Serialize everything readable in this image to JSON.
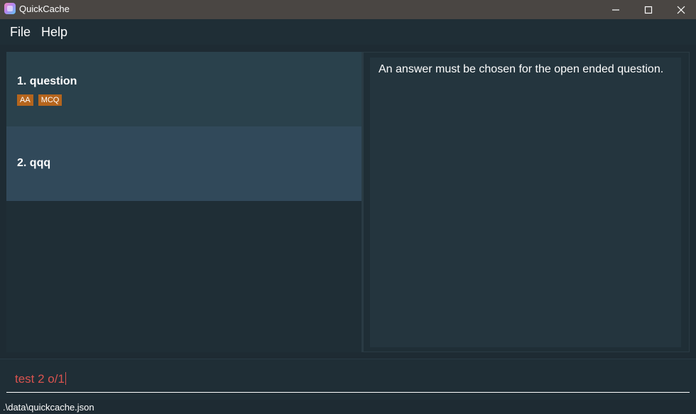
{
  "window": {
    "title": "QuickCache",
    "icon": "quickcache-app-icon",
    "controls": [
      "minimize-icon",
      "maximize-icon",
      "close-icon"
    ]
  },
  "menu": {
    "file": "File",
    "help": "Help"
  },
  "question_list": {
    "items": [
      {
        "title": "1.  question",
        "tags": [
          "AA",
          "MCQ"
        ]
      },
      {
        "title": "2.  qqq",
        "tags": []
      }
    ]
  },
  "result_display": {
    "message": "An answer must be chosen for the open ended question."
  },
  "command_box": {
    "value": "test 2 o/1",
    "text_color": "#d9534f"
  },
  "status_bar": {
    "path": ".\\data\\quickcache.json"
  },
  "colors": {
    "tag_background": "#b5651d",
    "selected_card": "#31495a",
    "card": "#2a414c"
  }
}
